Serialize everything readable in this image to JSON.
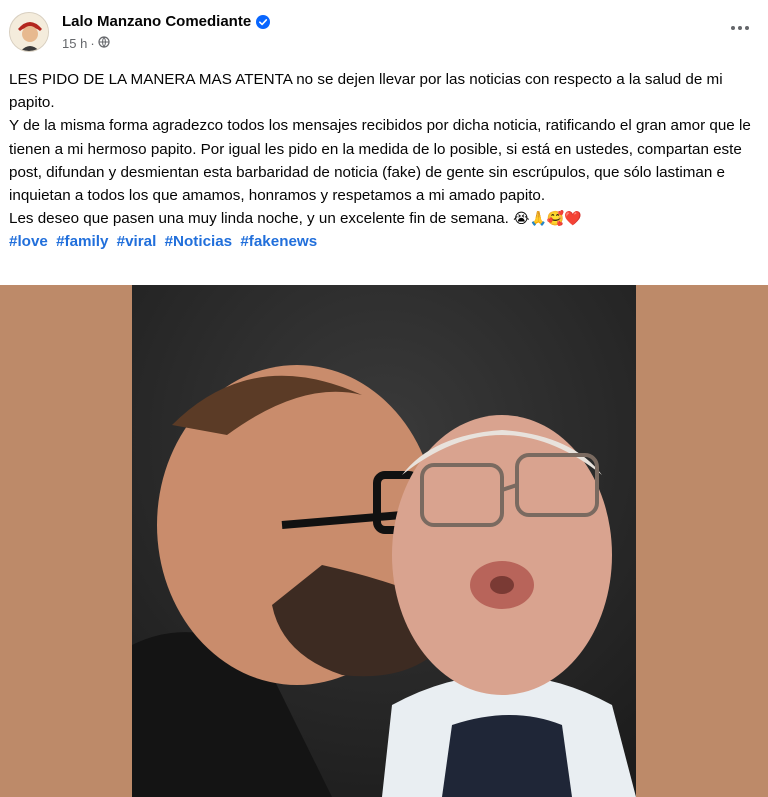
{
  "post": {
    "author": "Lalo Manzano Comediante",
    "time": "15 h",
    "separator": "·",
    "text_lines": [
      "LES PIDO DE LA MANERA MAS ATENTA no se dejen llevar por las noticias con respecto a la salud de mi papito.",
      "Y de la misma forma agradezco todos los mensajes recibidos por dicha noticia, ratificando el gran amor que le tienen a mi hermoso papito. Por igual les pido en la medida de lo posible, si está en ustedes, compartan este post, difundan y desmientan esta barbaridad de noticia (fake) de gente sin escrúpulos, que sólo lastiman e inquietan a todos los que amamos, honramos y respetamos a mi amado papito.",
      "Les deseo que pasen una muy linda noche, y un excelente fin de semana."
    ],
    "emojis": "😭🙏🥰❤️",
    "hashtags": [
      "#love",
      "#family",
      "#viral",
      "#Noticias",
      "#fakenews"
    ]
  },
  "icons": {
    "verified": "verified-badge-icon",
    "audience": "globe-icon",
    "more": "more-options-icon"
  },
  "colors": {
    "hashtag": "#216fdb",
    "verified": "#0866ff",
    "image_background": "#bd8a69",
    "meta_text": "#65676b"
  }
}
